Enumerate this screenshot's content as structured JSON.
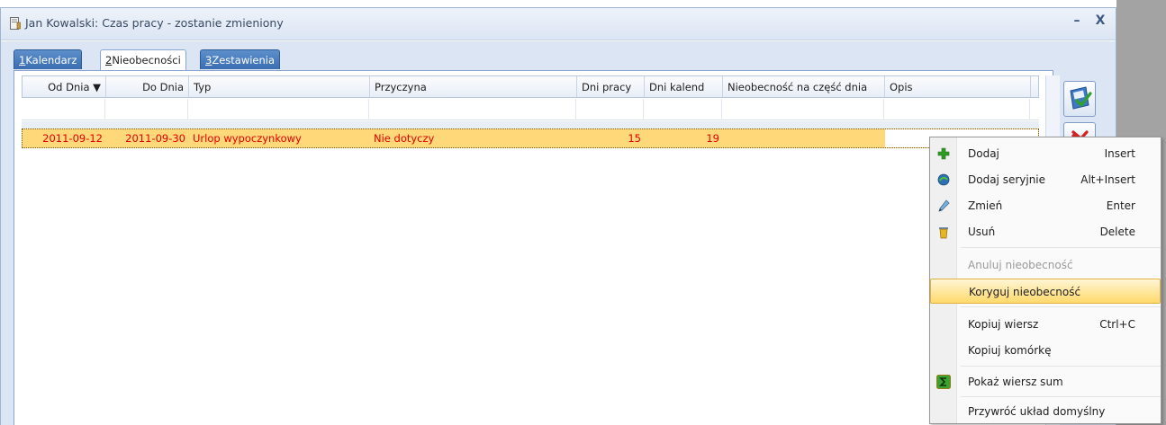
{
  "window": {
    "title": "Jan Kowalski: Czas pracy - zostanie zmieniony",
    "minimize": "–",
    "close": "X"
  },
  "tabs": [
    {
      "key": "1",
      "label": "Kalendarz",
      "active": false
    },
    {
      "key": "2",
      "label": "Nieobecności",
      "active": true
    },
    {
      "key": "3",
      "label": "Zestawienia",
      "active": false
    }
  ],
  "grid": {
    "columns": [
      "Od Dnia ▼",
      "Do Dnia",
      "Typ",
      "Przyczyna",
      "Dni pracy",
      "Dni kalend",
      "Nieobecność na część dnia",
      "Opis"
    ],
    "rows": [
      {
        "od": "2011-09-12",
        "do": "2011-09-30",
        "typ": "Urlop wypoczynkowy",
        "przyczyna": "Nie dotyczy",
        "dni_pracy": "15",
        "dni_kalend": "19",
        "czesc_dnia": "",
        "opis": ""
      }
    ]
  },
  "context_menu": {
    "items": [
      {
        "label": "Dodaj",
        "shortcut": "Insert",
        "icon": "plus-icon"
      },
      {
        "label": "Dodaj seryjnie",
        "shortcut": "Alt+Insert",
        "icon": "batch-add-icon"
      },
      {
        "label": "Zmień",
        "shortcut": "Enter",
        "icon": "edit-pen-icon"
      },
      {
        "label": "Usuń",
        "shortcut": "Delete",
        "icon": "trash-icon"
      },
      {
        "label": "Anuluj nieobecność",
        "shortcut": "",
        "disabled": true
      },
      {
        "label": "Koryguj nieobecność",
        "shortcut": "",
        "highlighted": true
      },
      {
        "label": "Kopiuj wiersz",
        "shortcut": "Ctrl+C"
      },
      {
        "label": "Kopiuj komórkę",
        "shortcut": ""
      },
      {
        "label": "Pokaż wiersz sum",
        "shortcut": "",
        "icon": "sum-icon"
      },
      {
        "label": "Przywróć układ domyślny",
        "shortcut": ""
      }
    ]
  },
  "colors": {
    "row_highlight": "#ffd87a",
    "row_text": "#e10000",
    "tab_blue": "#3a6eb2"
  }
}
